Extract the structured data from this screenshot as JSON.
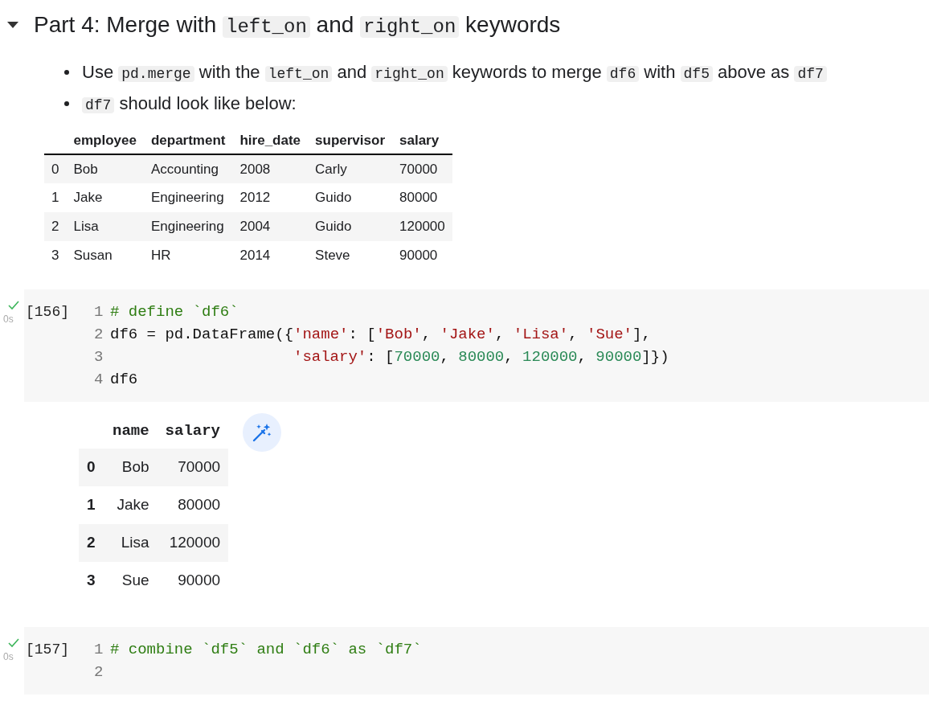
{
  "section": {
    "expanded": true,
    "heading": [
      {
        "kind": "text",
        "text": "Part 4: Merge with "
      },
      {
        "kind": "code",
        "text": "left_on"
      },
      {
        "kind": "text",
        "text": " and "
      },
      {
        "kind": "code",
        "text": "right_on"
      },
      {
        "kind": "text",
        "text": " keywords"
      }
    ],
    "bullets": [
      [
        {
          "kind": "text",
          "text": "Use "
        },
        {
          "kind": "code",
          "text": "pd.merge"
        },
        {
          "kind": "text",
          "text": " with the "
        },
        {
          "kind": "code",
          "text": "left_on"
        },
        {
          "kind": "text",
          "text": " and "
        },
        {
          "kind": "code",
          "text": "right_on"
        },
        {
          "kind": "text",
          "text": " keywords to merge "
        },
        {
          "kind": "code",
          "text": "df6"
        },
        {
          "kind": "text",
          "text": " with "
        },
        {
          "kind": "code",
          "text": "df5"
        },
        {
          "kind": "text",
          "text": " above as "
        },
        {
          "kind": "code",
          "text": "df7"
        }
      ],
      [
        {
          "kind": "code",
          "text": "df7"
        },
        {
          "kind": "text",
          "text": " should look like below:"
        }
      ]
    ],
    "table": {
      "columns": [
        "",
        "employee",
        "department",
        "hire_date",
        "supervisor",
        "salary"
      ],
      "rows": [
        [
          "0",
          "Bob",
          "Accounting",
          "2008",
          "Carly",
          "70000"
        ],
        [
          "1",
          "Jake",
          "Engineering",
          "2012",
          "Guido",
          "80000"
        ],
        [
          "2",
          "Lisa",
          "Engineering",
          "2004",
          "Guido",
          "120000"
        ],
        [
          "3",
          "Susan",
          "HR",
          "2014",
          "Steve",
          "90000"
        ]
      ]
    }
  },
  "cells": [
    {
      "count": "[156]",
      "succeeded": true,
      "time": "0s",
      "lines": [
        {
          "number": "1",
          "tokens": [
            {
              "kind": "comment",
              "text": "# define `df6`"
            }
          ]
        },
        {
          "number": "2",
          "tokens": [
            {
              "kind": "plain",
              "text": "df6 = pd.DataFrame({"
            },
            {
              "kind": "string",
              "text": "'name'"
            },
            {
              "kind": "plain",
              "text": ": ["
            },
            {
              "kind": "string",
              "text": "'Bob'"
            },
            {
              "kind": "plain",
              "text": ", "
            },
            {
              "kind": "string",
              "text": "'Jake'"
            },
            {
              "kind": "plain",
              "text": ", "
            },
            {
              "kind": "string",
              "text": "'Lisa'"
            },
            {
              "kind": "plain",
              "text": ", "
            },
            {
              "kind": "string",
              "text": "'Sue'"
            },
            {
              "kind": "plain",
              "text": "],"
            }
          ]
        },
        {
          "number": "3",
          "continuation": true,
          "tokens": [
            {
              "kind": "string",
              "text": "'salary'"
            },
            {
              "kind": "plain",
              "text": ": ["
            },
            {
              "kind": "number",
              "text": "70000"
            },
            {
              "kind": "plain",
              "text": ", "
            },
            {
              "kind": "number",
              "text": "80000"
            },
            {
              "kind": "plain",
              "text": ", "
            },
            {
              "kind": "number",
              "text": "120000"
            },
            {
              "kind": "plain",
              "text": ", "
            },
            {
              "kind": "number",
              "text": "90000"
            },
            {
              "kind": "plain",
              "text": "]})"
            }
          ]
        },
        {
          "number": "4",
          "tokens": [
            {
              "kind": "plain",
              "text": "df6"
            }
          ]
        }
      ],
      "output": {
        "columns": [
          "",
          "name",
          "salary"
        ],
        "rows": [
          [
            "0",
            "Bob",
            "70000"
          ],
          [
            "1",
            "Jake",
            "80000"
          ],
          [
            "2",
            "Lisa",
            "120000"
          ],
          [
            "3",
            "Sue",
            "90000"
          ]
        ]
      }
    },
    {
      "count": "[157]",
      "succeeded": true,
      "time": "0s",
      "lines": [
        {
          "number": "1",
          "tokens": [
            {
              "kind": "comment",
              "text": "# combine `df5` and `df6` as `df7`"
            }
          ]
        },
        {
          "number": "2"
        }
      ]
    }
  ]
}
